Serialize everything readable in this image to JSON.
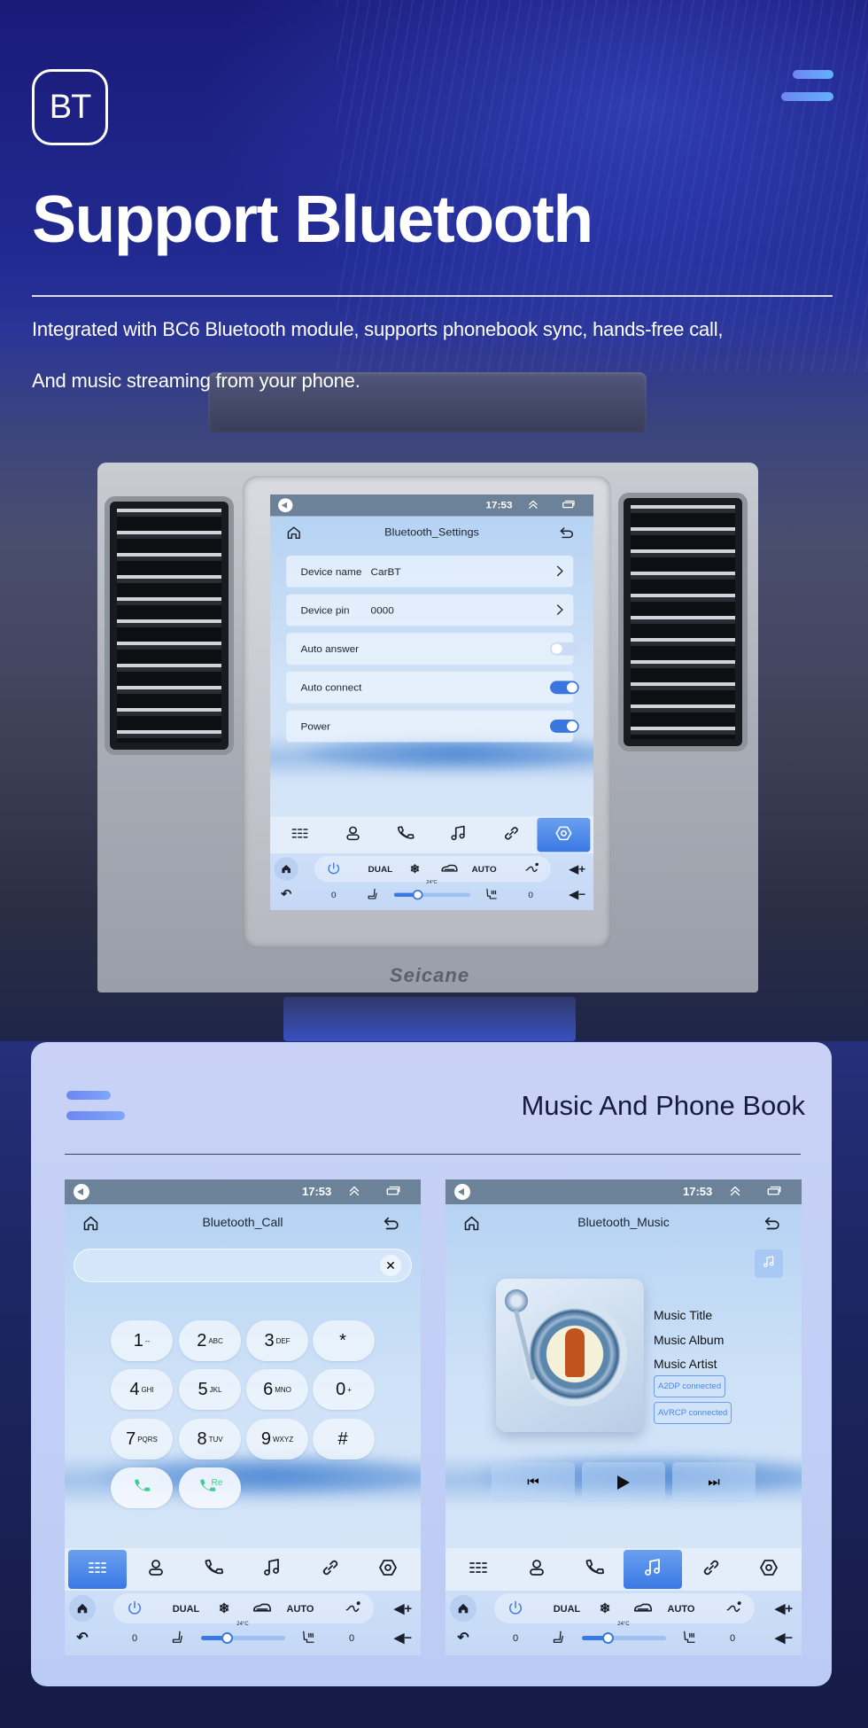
{
  "hero": {
    "badge": "BT",
    "title": "Support Bluetooth",
    "description_line1": "Integrated with BC6 Bluetooth module, supports phonebook sync, hands-free call,",
    "description_line2": "And music streaming from your phone.",
    "brand_logo": "Seicane"
  },
  "card": {
    "title": "Music And Phone Book"
  },
  "status": {
    "time": "17:53"
  },
  "climate": {
    "dual": "DUAL",
    "auto": "AUTO",
    "temp": "24°C",
    "left_level": "0",
    "right_level": "0",
    "fan_level_fraction": 0.3
  },
  "tabs": [
    {
      "icon": "dialpad-icon"
    },
    {
      "icon": "contacts-icon"
    },
    {
      "icon": "call-log-icon"
    },
    {
      "icon": "music-icon"
    },
    {
      "icon": "link-icon"
    },
    {
      "icon": "settings-icon"
    }
  ],
  "settings_screen": {
    "title": "Bluetooth_Settings",
    "active_tab": 5,
    "rows": [
      {
        "label": "Device name",
        "value": "CarBT",
        "type": "link"
      },
      {
        "label": "Device pin",
        "value": "0000",
        "type": "link"
      },
      {
        "label": "Auto answer",
        "type": "toggle",
        "on": false
      },
      {
        "label": "Auto connect",
        "type": "toggle",
        "on": true
      },
      {
        "label": "Power",
        "type": "toggle",
        "on": true
      }
    ]
  },
  "call_screen": {
    "title": "Bluetooth_Call",
    "active_tab": 0,
    "number_input": "",
    "keys": [
      {
        "digit": "1",
        "letters": "--"
      },
      {
        "digit": "2",
        "letters": "ABC"
      },
      {
        "digit": "3",
        "letters": "DEF"
      },
      {
        "digit": "*",
        "letters": ""
      },
      {
        "digit": "4",
        "letters": "GHI"
      },
      {
        "digit": "5",
        "letters": "JKL"
      },
      {
        "digit": "6",
        "letters": "MNO"
      },
      {
        "digit": "0",
        "letters": "+"
      },
      {
        "digit": "7",
        "letters": "PQRS"
      },
      {
        "digit": "8",
        "letters": "TUV"
      },
      {
        "digit": "9",
        "letters": "WXYZ"
      },
      {
        "digit": "#",
        "letters": ""
      }
    ],
    "redial_label": "Re"
  },
  "music_screen": {
    "title": "Bluetooth_Music",
    "active_tab": 3,
    "track_title": "Music Title",
    "album": "Music Album",
    "artist": "Music Artist",
    "badges": [
      "A2DP  connected",
      "AVRCP connected"
    ]
  },
  "colors": {
    "accent": "#3a78e4",
    "toggle_on": "#3b76e0",
    "toggle_off": "#c9dbf5",
    "call_green": "#3ecf8e",
    "status_bar": "#6b8298",
    "card_bg": "#c9d2f6"
  }
}
